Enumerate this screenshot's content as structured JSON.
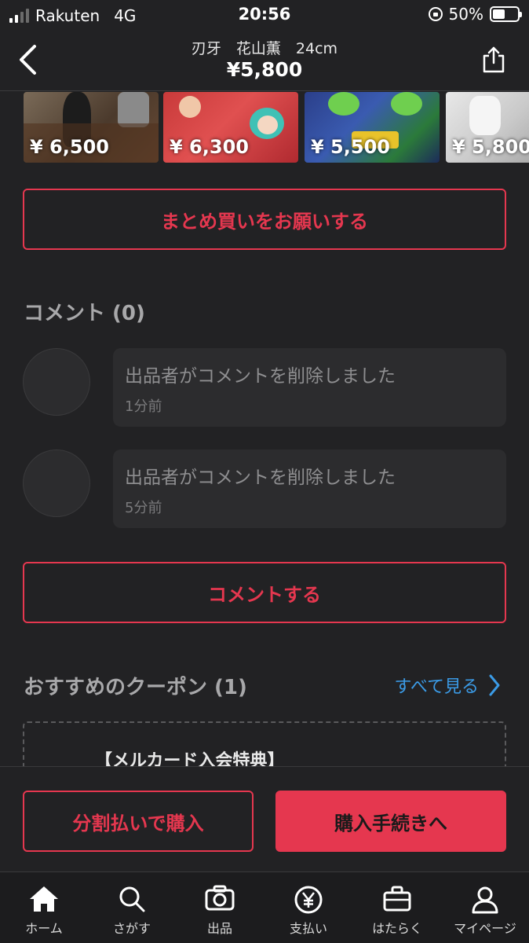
{
  "status_bar": {
    "carrier": "Rakuten",
    "network": "4G",
    "time": "20:56",
    "battery": "50%",
    "battery_level": 0.5
  },
  "header": {
    "title": "刃牙　花山薫　24cm",
    "price": "¥5,800"
  },
  "thumbnails": [
    {
      "price": "¥ 6,500"
    },
    {
      "price": "¥ 6,300"
    },
    {
      "price": "¥ 5,500"
    },
    {
      "price": "¥ 5,800"
    }
  ],
  "bulk_request_button": "まとめ買いをお願いする",
  "comments_section": {
    "title": "コメント (0)",
    "comments": [
      {
        "text": "出品者がコメントを削除しました",
        "time": "1分前"
      },
      {
        "text": "出品者がコメントを削除しました",
        "time": "5分前"
      }
    ],
    "comment_button": "コメントする"
  },
  "coupons": {
    "title": "おすすめのクーポン (1)",
    "see_all": "すべて見る",
    "first_coupon_title": "【メルカード入会特典】"
  },
  "purchase_bar": {
    "split_pay": "分割払いで購入",
    "buy": "購入手続きへ"
  },
  "tab_bar": {
    "home": "ホーム",
    "search": "さがす",
    "sell": "出品",
    "pay": "支払い",
    "work": "はたらく",
    "mypage": "マイページ"
  },
  "colors": {
    "accent": "#e5374f",
    "link": "#3b9be6",
    "background": "#222224"
  }
}
